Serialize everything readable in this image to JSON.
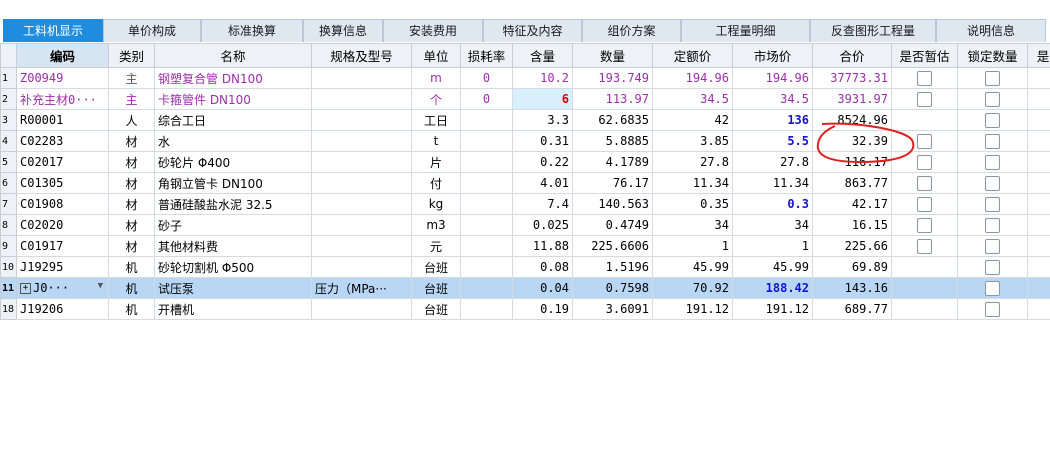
{
  "tabs": [
    "工料机显示",
    "单价构成",
    "标准换算",
    "换算信息",
    "安装费用",
    "特征及内容",
    "组价方案",
    "工程量明细",
    "反查图形工程量",
    "说明信息"
  ],
  "active_tab": 0,
  "columns": [
    "",
    "编码",
    "类别",
    "名称",
    "规格及型号",
    "单位",
    "损耗率",
    "含量",
    "数量",
    "定额价",
    "市场价",
    "合价",
    "是否暂估",
    "锁定数量",
    "是"
  ],
  "rows": [
    {
      "rn": "1",
      "code": "Z00949",
      "type": "主",
      "name": "钢塑复合管 DN100",
      "spec": "",
      "unit": "m",
      "loss": "0",
      "content": "10.2",
      "qty": "193.749",
      "quota": "194.96",
      "market": "194.96",
      "total": "37773.31",
      "est": true,
      "lock": true
    },
    {
      "rn": "2",
      "code": "补充主材0···",
      "type": "主",
      "name": "卡箍管件 DN100",
      "spec": "",
      "unit": "个",
      "loss": "0",
      "content": "6",
      "qty": "113.97",
      "quota": "34.5",
      "market": "34.5",
      "total": "3931.97",
      "est": true,
      "lock": true
    },
    {
      "rn": "3",
      "code": "R00001",
      "type": "人",
      "name": "综合工日",
      "spec": "",
      "unit": "工日",
      "loss": "",
      "content": "3.3",
      "qty": "62.6835",
      "quota": "42",
      "market": "136",
      "total": "8524.96",
      "est": false,
      "lock": true
    },
    {
      "rn": "4",
      "code": "C02283",
      "type": "材",
      "name": "水",
      "spec": "",
      "unit": "t",
      "loss": "",
      "content": "0.31",
      "qty": "5.8885",
      "quota": "3.85",
      "market": "5.5",
      "total": "32.39",
      "est": true,
      "lock": true
    },
    {
      "rn": "5",
      "code": "C02017",
      "type": "材",
      "name": "砂轮片 Φ400",
      "spec": "",
      "unit": "片",
      "loss": "",
      "content": "0.22",
      "qty": "4.1789",
      "quota": "27.8",
      "market": "27.8",
      "total": "116.17",
      "est": true,
      "lock": true
    },
    {
      "rn": "6",
      "code": "C01305",
      "type": "材",
      "name": "角钢立管卡 DN100",
      "spec": "",
      "unit": "付",
      "loss": "",
      "content": "4.01",
      "qty": "76.17",
      "quota": "11.34",
      "market": "11.34",
      "total": "863.77",
      "est": true,
      "lock": true
    },
    {
      "rn": "7",
      "code": "C01908",
      "type": "材",
      "name": "普通硅酸盐水泥 32.5",
      "spec": "",
      "unit": "kg",
      "loss": "",
      "content": "7.4",
      "qty": "140.563",
      "quota": "0.35",
      "market": "0.3",
      "total": "42.17",
      "est": true,
      "lock": true
    },
    {
      "rn": "8",
      "code": "C02020",
      "type": "材",
      "name": "砂子",
      "spec": "",
      "unit": "m3",
      "loss": "",
      "content": "0.025",
      "qty": "0.4749",
      "quota": "34",
      "market": "34",
      "total": "16.15",
      "est": true,
      "lock": true
    },
    {
      "rn": "9",
      "code": "C01917",
      "type": "材",
      "name": "其他材料费",
      "spec": "",
      "unit": "元",
      "loss": "",
      "content": "11.88",
      "qty": "225.6606",
      "quota": "1",
      "market": "1",
      "total": "225.66",
      "est": true,
      "lock": true
    },
    {
      "rn": "10",
      "code": "J19295",
      "type": "机",
      "name": "砂轮切割机 Φ500",
      "spec": "",
      "unit": "台班",
      "loss": "",
      "content": "0.08",
      "qty": "1.5196",
      "quota": "45.99",
      "market": "45.99",
      "total": "69.89",
      "est": false,
      "lock": true
    },
    {
      "rn": "11",
      "code": "J0···",
      "type": "机",
      "name": "试压泵",
      "spec": "压力（MPa···",
      "unit": "台班",
      "loss": "",
      "content": "0.04",
      "qty": "0.7598",
      "quota": "70.92",
      "market": "188.42",
      "total": "143.16",
      "est": false,
      "lock": true
    },
    {
      "rn": "18",
      "code": "J19206",
      "type": "机",
      "name": "开槽机",
      "spec": "",
      "unit": "台班",
      "loss": "",
      "content": "0.19",
      "qty": "3.6091",
      "quota": "191.12",
      "market": "191.12",
      "total": "689.77",
      "est": false,
      "lock": true
    }
  ]
}
